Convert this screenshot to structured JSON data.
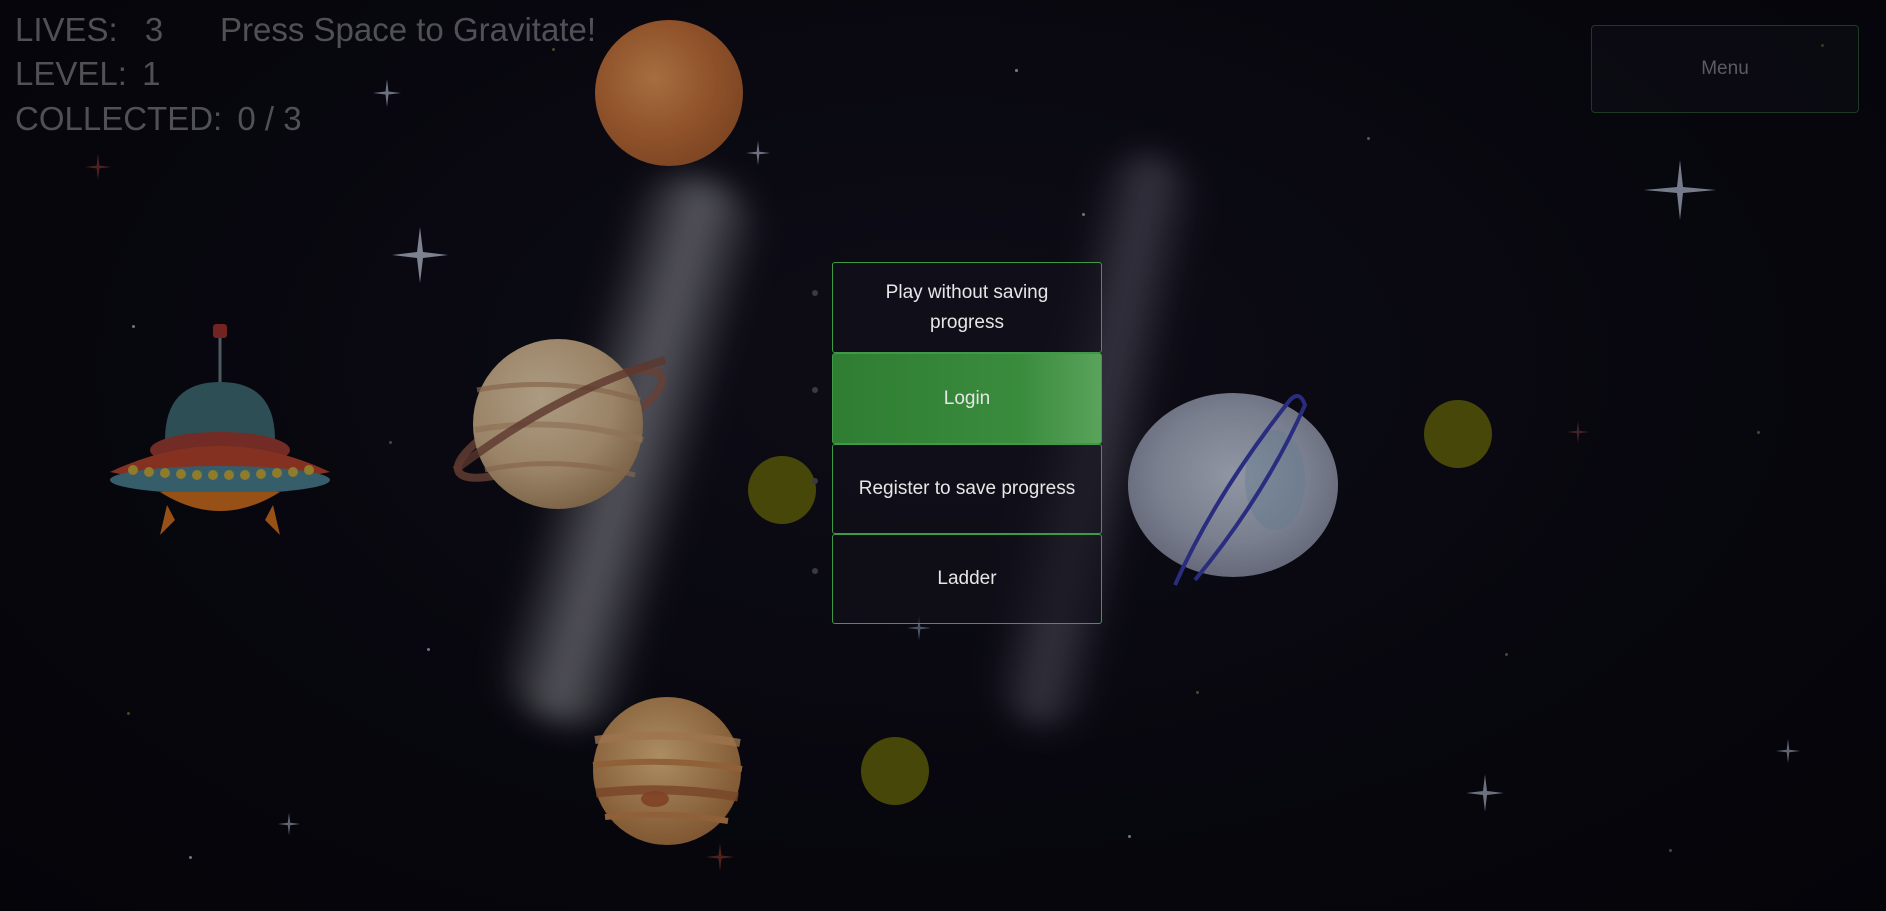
{
  "hud": {
    "lives_label": "LIVES:",
    "lives_value": "3",
    "hint": "Press Space to Gravitate!",
    "level_label": "LEVEL:",
    "level_value": "1",
    "collected_label": "COLLECTED:",
    "collected_value": "0 / 3"
  },
  "menu_button": {
    "label": "Menu"
  },
  "dialog": {
    "options": [
      {
        "label": "Play without saving progress",
        "primary": false
      },
      {
        "label": "Login",
        "primary": true
      },
      {
        "label": "Register to save progress",
        "primary": false
      },
      {
        "label": "Ladder",
        "primary": false
      }
    ]
  },
  "game": {
    "lives": 3,
    "level": 1,
    "collected": 0,
    "total": 3,
    "coins_visible": 3,
    "player": "ufo-icon"
  },
  "colors": {
    "accent": "#3a8c3d",
    "coin": "#65630e",
    "background": "#0b0a14"
  }
}
